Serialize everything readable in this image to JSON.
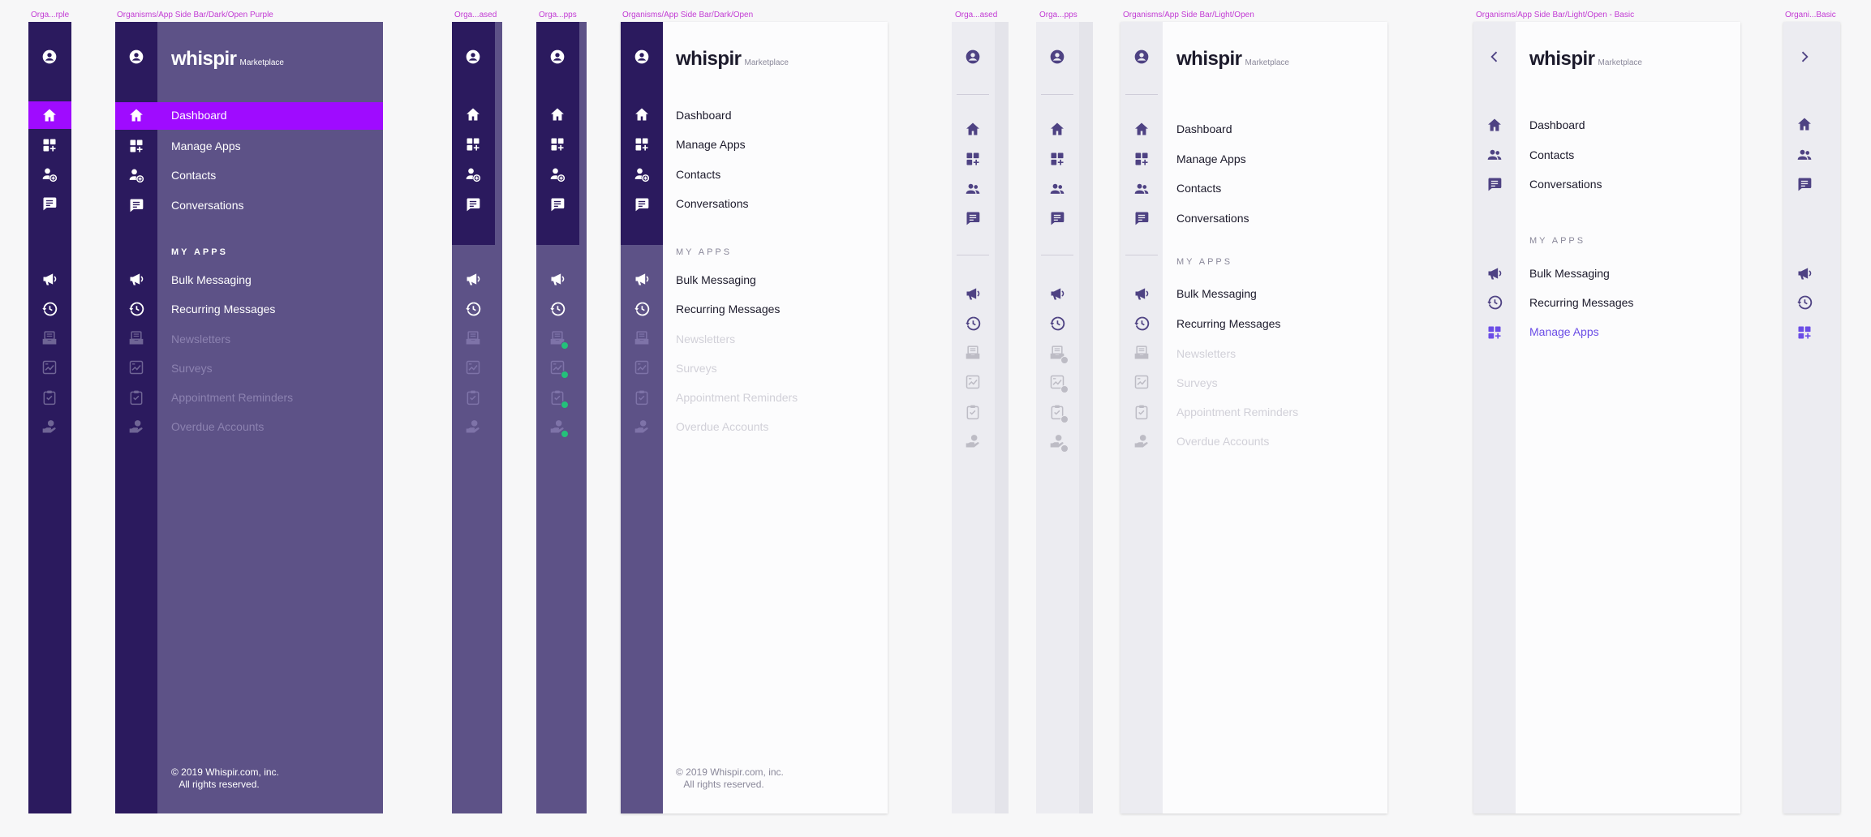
{
  "labels": {
    "f1": "Orga...rple",
    "f2": "Organisms/App Side Bar/Dark/Open Purple",
    "f3": "Orga...ased",
    "f4": "Orga...pps",
    "f5": "Organisms/App Side Bar/Dark/Open",
    "f6": "Orga...ased",
    "f7": "Orga...pps",
    "f8": "Organisms/App Side Bar/Light/Open",
    "f9": "Organisms/App Side Bar/Light/Open - Basic",
    "f10": "Organi...Basic"
  },
  "brand": {
    "name": "whispir",
    "sub": "Marketplace"
  },
  "nav": {
    "dashboard": "Dashboard",
    "manage_apps": "Manage Apps",
    "contacts": "Contacts",
    "conversations": "Conversations"
  },
  "my_apps": {
    "title": "MY APPS",
    "bulk": "Bulk Messaging",
    "recurring": "Recurring Messages",
    "newsletters": "Newsletters",
    "surveys": "Surveys",
    "appointments": "Appointment Reminders",
    "overdue": "Overdue Accounts",
    "manage_apps": "Manage Apps"
  },
  "footer": "© 2019 Whispir.com, inc.\n   All rights reserved.",
  "colors": {
    "dark_rail": "#2b1a5e",
    "dark_panel": "#5d5287",
    "highlight": "#9f0bff",
    "light_rail": "#ececf1",
    "light_panel": "#fcfcfd",
    "icon_light": "#4e4283",
    "accent_link": "#6b4de6",
    "badge": "#24c17a"
  }
}
